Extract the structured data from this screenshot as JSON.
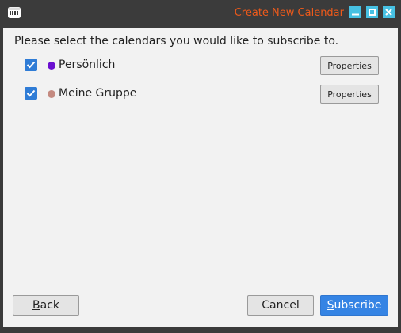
{
  "window": {
    "title": "Create New Calendar",
    "controls": {
      "minimize": "minimize-icon",
      "maximize": "maximize-icon",
      "close": "close-icon"
    },
    "title_color": "#ef5a1a",
    "control_color": "#47c1e3"
  },
  "main": {
    "prompt": "Please select the calendars you would like to subscribe to.",
    "calendars": [
      {
        "name": "Persönlich",
        "checked": true,
        "color": "#6a0fd0",
        "properties_label": "Properties"
      },
      {
        "name": "Meine Gruppe",
        "checked": true,
        "color": "#c48a80",
        "properties_label": "Properties"
      }
    ]
  },
  "footer": {
    "back": {
      "mnemonic": "B",
      "rest": "ack"
    },
    "cancel": "Cancel",
    "subscribe": {
      "mnemonic": "S",
      "rest": "ubscribe"
    },
    "accent": "#3584e4"
  }
}
